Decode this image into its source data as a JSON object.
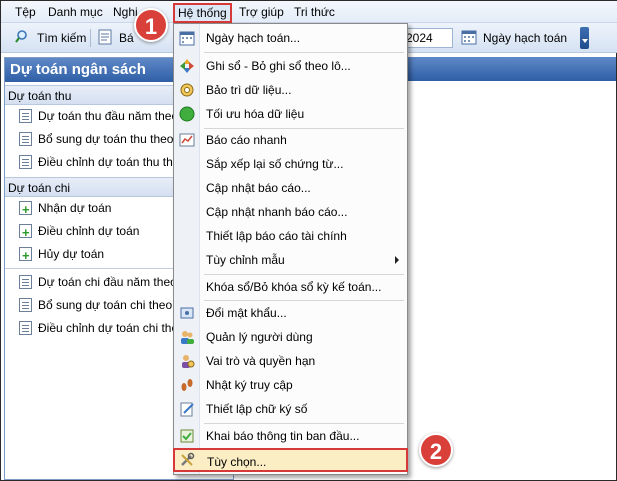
{
  "menubar": {
    "items": [
      "Tệp",
      "Danh mục",
      "Nghi",
      "Hệ thống",
      "Trợ giúp",
      "Tri thức"
    ]
  },
  "toolbar": {
    "search_label": "Tìm kiếm",
    "partial_label": "Bá",
    "year_value": "2024",
    "accounting_date_label": "Ngày hạch toán"
  },
  "left_panel": {
    "title": "Dự toán ngân sách",
    "sections": [
      {
        "label": "Dự toán thu",
        "items": [
          "Dự toán thu đầu năm theo N",
          "Bổ sung dự toán thu theo N",
          "Điều chỉnh dự toán thu theo"
        ]
      },
      {
        "label": "Dự toán chi",
        "items": [
          "Nhận dự toán",
          "Điều chỉnh dự toán",
          "Hủy dự toán"
        ],
        "items2": [
          "Dự toán chi đầu năm theo N",
          "Bổ sung dự toán chi theo N",
          "Điều chỉnh dự toán chi theo"
        ]
      }
    ]
  },
  "dropdown": {
    "items": [
      "Ngày hạch toán...",
      "Ghi sổ - Bỏ ghi sổ theo lô...",
      "Bảo trì dữ liệu...",
      "Tối ưu hóa dữ liệu",
      "Báo cáo nhanh",
      "Sắp xếp lại số chứng từ...",
      "Cập nhật báo cáo...",
      "Cập nhật nhanh báo cáo...",
      "Thiết lập báo cáo tài chính",
      "Tùy chỉnh mẫu",
      "Khóa sổ/Bỏ khóa sổ kỳ kế toán...",
      "Đổi mật khẩu...",
      "Quản lý người dùng",
      "Vai trò và quyền hạn",
      "Nhật ký truy cập",
      "Thiết lập chữ ký số",
      "Khai báo thông tin ban đầu...",
      "Tùy chọn..."
    ]
  },
  "badges": [
    "1",
    "2"
  ],
  "colors": {
    "highlight_border": "#d73838",
    "badge": "#d9403a",
    "panel_header": "#2f5fa6"
  }
}
